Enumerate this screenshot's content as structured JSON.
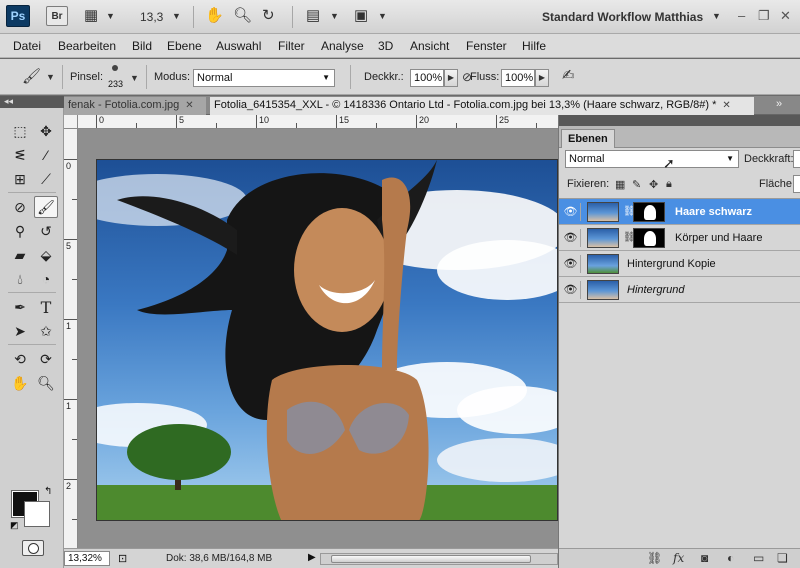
{
  "app": {
    "logo": "Ps",
    "bridge": "Br",
    "zoom": "13,3",
    "workspace": "Standard Workflow Matthias"
  },
  "menu": [
    "Datei",
    "Bearbeiten",
    "Bild",
    "Ebene",
    "Auswahl",
    "Filter",
    "Analyse",
    "3D",
    "Ansicht",
    "Fenster",
    "Hilfe"
  ],
  "options": {
    "brush_label": "Pinsel:",
    "brush_size": "233",
    "mode_label": "Modus:",
    "mode_value": "Normal",
    "opacity_label": "Deckkr.:",
    "opacity_value": "100%",
    "flow_label": "Fluss:",
    "flow_value": "100%"
  },
  "tabs": [
    {
      "label": "fenak - Fotolia.com.jpg",
      "active": false
    },
    {
      "label": "Fotolia_6415354_XXL - © 1418336 Ontario Ltd - Fotolia.com.jpg bei 13,3% (Haare schwarz, RGB/8#) *",
      "active": true
    }
  ],
  "rulers": {
    "h": [
      "0",
      "5",
      "10",
      "15",
      "20",
      "25"
    ],
    "v": [
      "0",
      "5",
      "1",
      "1",
      "2"
    ]
  },
  "status": {
    "zoom": "13,32%",
    "doc": "Dok: 38,6 MB/164,8 MB"
  },
  "layers_panel": {
    "tab": "Ebenen",
    "blend_mode": "Normal",
    "opacity_label": "Deckkraft:",
    "lock_label": "Fixieren:",
    "fill_label": "Fläche:",
    "layers": [
      {
        "name": "Haare schwarz",
        "selected": true,
        "mask": true,
        "style": "bold"
      },
      {
        "name": "Körper und Haare",
        "selected": false,
        "mask": true,
        "style": "normal"
      },
      {
        "name": "Hintergrund Kopie",
        "selected": false,
        "mask": false,
        "style": "normal"
      },
      {
        "name": "Hintergrund",
        "selected": false,
        "mask": false,
        "style": "italic"
      }
    ]
  },
  "colors": {
    "foreground": "#111111",
    "background": "#ffffff",
    "selection": "#4a8fe3"
  }
}
